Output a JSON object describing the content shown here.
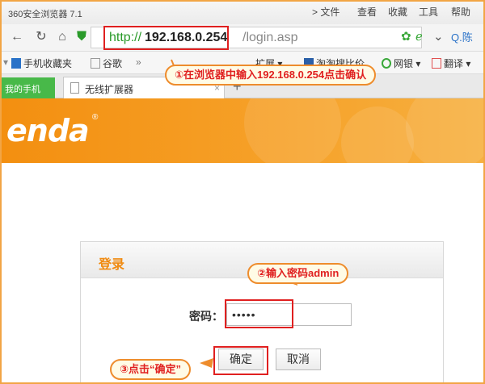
{
  "window": {
    "title": "360安全浏览器 7.1"
  },
  "menu": {
    "file": "> 文件",
    "view": "查看",
    "favorites": "收藏",
    "tools": "工具",
    "help": "帮助"
  },
  "address": {
    "protocol": "http://",
    "host": "192.168.0.254",
    "path": "/login.asp",
    "search_hint": "Q.陈"
  },
  "bookmarks": {
    "mobile_favorites": "手机收藏夹",
    "google": "谷歌",
    "more": "»",
    "extension": "扩展",
    "taobao": "淘淘搜比价",
    "bank": "网银",
    "translate": "翻译"
  },
  "tabs": {
    "my_phone": "我的手机",
    "active": "无线扩展器",
    "close": "×",
    "new": "+"
  },
  "brand": {
    "logo": "enda",
    "accent": "#f38f10"
  },
  "login": {
    "title": "登录",
    "password_label": "密码：",
    "password_value": "•••••",
    "confirm_label": "确定",
    "cancel_label": "取消"
  },
  "callouts": {
    "step1": "①在浏览器中输入192.168.0.254点击确认",
    "step2": "②输入密码admin",
    "step3": "③点击“确定”"
  },
  "colors": {
    "highlight": "#e02020",
    "callout_border": "#ee8c2c",
    "tab_green": "#48b949"
  }
}
